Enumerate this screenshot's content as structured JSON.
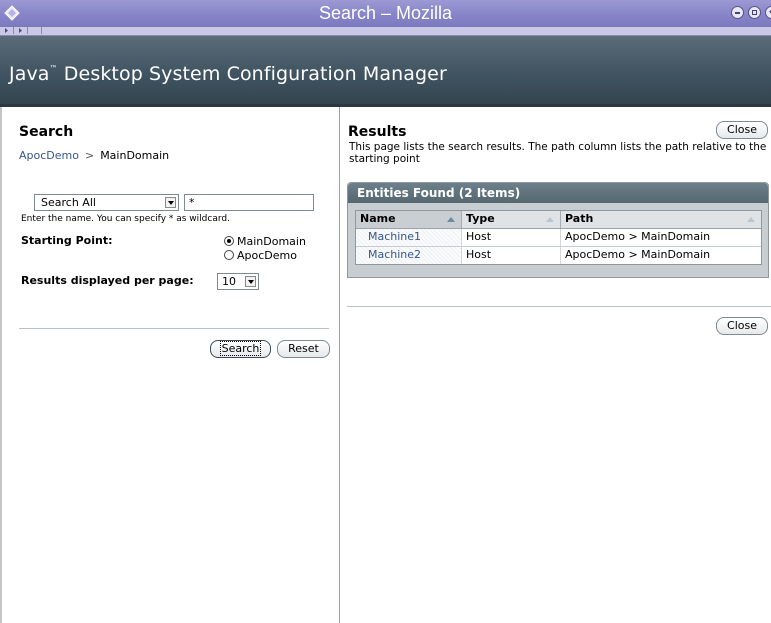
{
  "window": {
    "title": "Search – Mozilla",
    "icon": "diamond-app-icon"
  },
  "header": {
    "title": "Java",
    "tm": "™",
    "title_rest": " Desktop System Configuration Manager"
  },
  "search_panel": {
    "heading": "Search",
    "breadcrumb": {
      "root": "ApocDemo",
      "separator": ">",
      "current": "MainDomain"
    },
    "scope_select": {
      "value": "Search All"
    },
    "name_input": {
      "value": "*"
    },
    "hint": "Enter the name. You can specify * as wildcard.",
    "starting_point": {
      "label": "Starting Point:",
      "options": [
        "MainDomain",
        "ApocDemo"
      ],
      "selected": "MainDomain"
    },
    "results_per_page": {
      "label": "Results displayed per page:",
      "value": "10"
    },
    "search_button": "Search",
    "reset_button": "Reset"
  },
  "results_panel": {
    "heading": "Results",
    "close_button": "Close",
    "description": "This page lists the search results. The path column lists the path relative to the starting point",
    "table": {
      "title": "Entities Found (2 Items)",
      "columns": [
        "Name",
        "Type",
        "Path"
      ],
      "rows": [
        {
          "name": "Machine1",
          "type": "Host",
          "path": "ApocDemo > MainDomain"
        },
        {
          "name": "Machine2",
          "type": "Host",
          "path": "ApocDemo > MainDomain"
        }
      ]
    },
    "close_button_bottom": "Close"
  }
}
